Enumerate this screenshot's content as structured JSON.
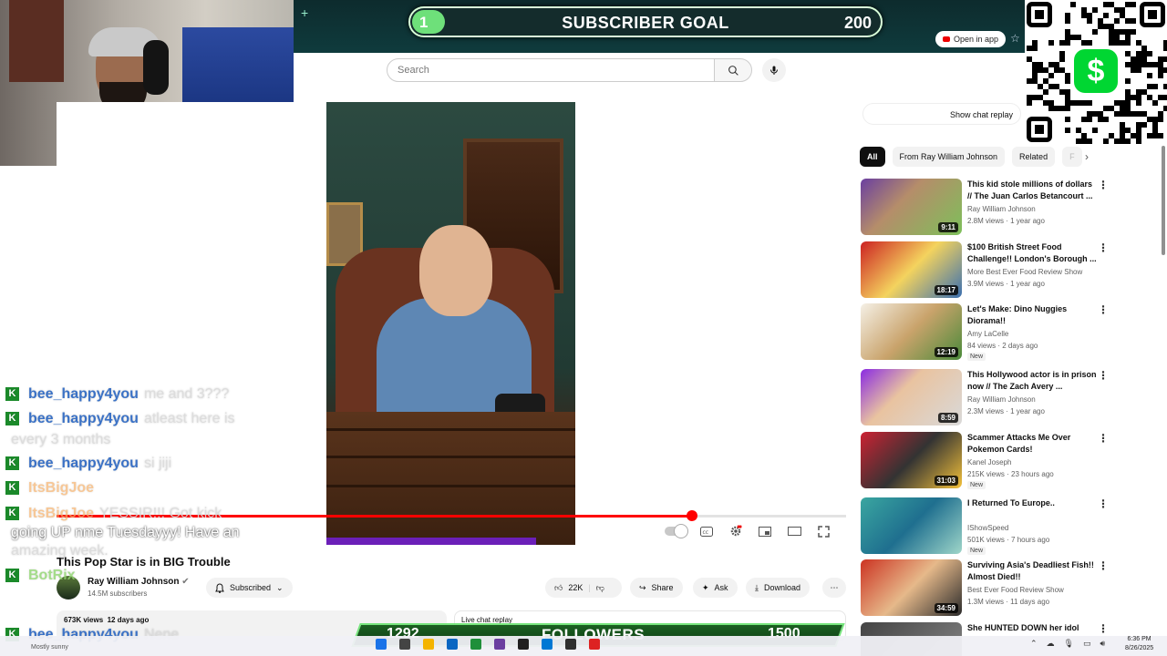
{
  "browser": {
    "new_tab": "+",
    "open_in_app": "Open in app"
  },
  "subscriber_goal": {
    "current": "1",
    "label": "SUBSCRIBER GOAL",
    "target": "200"
  },
  "search": {
    "placeholder": "Search"
  },
  "video": {
    "progress": 0.805,
    "title": "This Pop Star is in BIG Trouble",
    "channel": "Ray William Johnson",
    "subs": "14.5M subscribers",
    "subscribed_label": "Subscribed",
    "likes": "22K",
    "share_label": "Share",
    "ask_label": "Ask",
    "download_label": "Download",
    "views": "673K views",
    "age": "12 days ago",
    "live_chat_label": "Live chat replay"
  },
  "sidebar": {
    "show_chat_replay": "Show chat replay",
    "chips": [
      {
        "label": "All"
      },
      {
        "label": "From Ray William Johnson"
      },
      {
        "label": "Related"
      },
      {
        "label": "F"
      }
    ],
    "recommendations": [
      {
        "title": "This kid stole millions of dollars // The Juan Carlos Betancourt ...",
        "channel": "Ray William Johnson",
        "views": "2.8M views",
        "age": "1 year ago",
        "duration": "9:11",
        "badge": ""
      },
      {
        "title": "$100 British Street Food Challenge!! London's Borough ...",
        "channel": "More Best Ever Food Review Show",
        "views": "3.9M views",
        "age": "1 year ago",
        "duration": "18:17",
        "badge": ""
      },
      {
        "title": "Let's Make: Dino Nuggies Diorama!!",
        "channel": "Amy LaCelle",
        "views": "84 views",
        "age": "2 days ago",
        "duration": "12:19",
        "badge": "New"
      },
      {
        "title": "This Hollywood actor is in prison now // The Zach Avery ...",
        "channel": "Ray William Johnson",
        "views": "2.3M views",
        "age": "1 year ago",
        "duration": "8:59",
        "badge": ""
      },
      {
        "title": "Scammer Attacks Me Over Pokemon Cards!",
        "channel": "Kanel Joseph",
        "views": "215K views",
        "age": "23 hours ago",
        "duration": "31:03",
        "badge": "New"
      },
      {
        "title": "I Returned To Europe..",
        "channel": "IShowSpeed",
        "views": "501K views",
        "age": "7 hours ago",
        "duration": "",
        "badge": "New"
      },
      {
        "title": "Surviving Asia's Deadliest Fish!! Almost Died!!",
        "channel": "Best Ever Food Review Show",
        "views": "1.3M views",
        "age": "11 days ago",
        "duration": "34:59",
        "badge": ""
      },
      {
        "title": "She HUNTED DOWN her idol",
        "channel": "",
        "views": "",
        "age": "",
        "duration": "",
        "badge": ""
      }
    ]
  },
  "chat": [
    {
      "user": "bee_happy4you",
      "text": "me and 3???",
      "color": "blue"
    },
    {
      "user": "bee_happy4you",
      "text": "atleast here is",
      "color": "blue"
    },
    {
      "user": "",
      "text": "every 3 months",
      "color": "none"
    },
    {
      "user": "bee_happy4you",
      "text": "si jiji",
      "color": "blue"
    },
    {
      "user": "ItsBigJoe",
      "text": "",
      "color": "orange"
    },
    {
      "user": "ItsBigJoe",
      "text": "YESSIR!!! Got kick",
      "color": "orange"
    },
    {
      "user": "",
      "text": "going UP nme Tuesdayyy! Have an",
      "color": "none"
    },
    {
      "user": "",
      "text": "amazing week.",
      "color": "none"
    },
    {
      "user": "BotRix",
      "text": "",
      "color": "green"
    },
    {
      "user": "bee_happy4you",
      "text": "Nene",
      "color": "blue"
    }
  ],
  "followers_goal": {
    "current": "1292",
    "label": "FOLLOWERS",
    "target": "1500"
  },
  "taskbar": {
    "weather": "Mostly sunny",
    "time": "6:36 PM",
    "date": "8/26/2025"
  },
  "colors": {
    "youtube_red": "#ff0000",
    "goal_green": "#6ee07a",
    "cashapp_green": "#00d632",
    "chat_blue": "#3b72c6"
  }
}
